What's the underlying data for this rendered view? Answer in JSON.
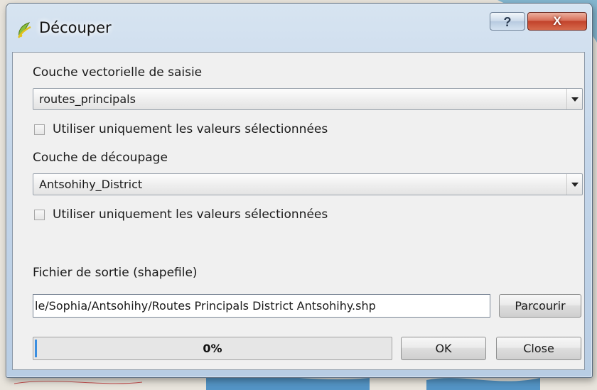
{
  "window": {
    "title": "Découper",
    "help_label": "?",
    "close_label": "X"
  },
  "input_layer": {
    "label": "Couche vectorielle de saisie",
    "selected": "routes_principals",
    "selected_only_label": "Utiliser uniquement les valeurs sélectionnées",
    "selected_only_checked": false
  },
  "clip_layer": {
    "label": "Couche de découpage",
    "selected": "Antsohihy_District",
    "selected_only_label": "Utiliser uniquement les valeurs sélectionnées",
    "selected_only_checked": false
  },
  "output": {
    "label": "Fichier de sortie (shapefile)",
    "value": "le/Sophia/Antsohihy/Routes Principals District Antsohihy.shp",
    "browse_label": "Parcourir"
  },
  "progress": {
    "text": "0%",
    "value": 0
  },
  "buttons": {
    "ok_label": "OK",
    "close_label": "Close"
  },
  "colors": {
    "accent": "#3a8ee0",
    "close_button": "#c2422b"
  },
  "icons": {
    "app": "qgis-icon",
    "dropdown": "chevron-down-icon"
  }
}
